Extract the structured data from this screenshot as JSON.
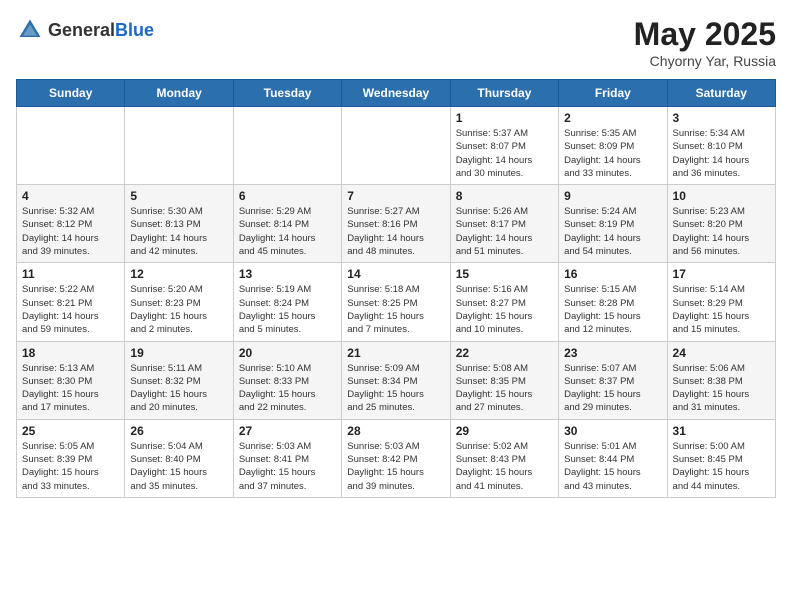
{
  "header": {
    "logo_general": "General",
    "logo_blue": "Blue",
    "month": "May 2025",
    "location": "Chyorny Yar, Russia"
  },
  "weekdays": [
    "Sunday",
    "Monday",
    "Tuesday",
    "Wednesday",
    "Thursday",
    "Friday",
    "Saturday"
  ],
  "weeks": [
    [
      {
        "day": "",
        "info": ""
      },
      {
        "day": "",
        "info": ""
      },
      {
        "day": "",
        "info": ""
      },
      {
        "day": "",
        "info": ""
      },
      {
        "day": "1",
        "info": "Sunrise: 5:37 AM\nSunset: 8:07 PM\nDaylight: 14 hours\nand 30 minutes."
      },
      {
        "day": "2",
        "info": "Sunrise: 5:35 AM\nSunset: 8:09 PM\nDaylight: 14 hours\nand 33 minutes."
      },
      {
        "day": "3",
        "info": "Sunrise: 5:34 AM\nSunset: 8:10 PM\nDaylight: 14 hours\nand 36 minutes."
      }
    ],
    [
      {
        "day": "4",
        "info": "Sunrise: 5:32 AM\nSunset: 8:12 PM\nDaylight: 14 hours\nand 39 minutes."
      },
      {
        "day": "5",
        "info": "Sunrise: 5:30 AM\nSunset: 8:13 PM\nDaylight: 14 hours\nand 42 minutes."
      },
      {
        "day": "6",
        "info": "Sunrise: 5:29 AM\nSunset: 8:14 PM\nDaylight: 14 hours\nand 45 minutes."
      },
      {
        "day": "7",
        "info": "Sunrise: 5:27 AM\nSunset: 8:16 PM\nDaylight: 14 hours\nand 48 minutes."
      },
      {
        "day": "8",
        "info": "Sunrise: 5:26 AM\nSunset: 8:17 PM\nDaylight: 14 hours\nand 51 minutes."
      },
      {
        "day": "9",
        "info": "Sunrise: 5:24 AM\nSunset: 8:19 PM\nDaylight: 14 hours\nand 54 minutes."
      },
      {
        "day": "10",
        "info": "Sunrise: 5:23 AM\nSunset: 8:20 PM\nDaylight: 14 hours\nand 56 minutes."
      }
    ],
    [
      {
        "day": "11",
        "info": "Sunrise: 5:22 AM\nSunset: 8:21 PM\nDaylight: 14 hours\nand 59 minutes."
      },
      {
        "day": "12",
        "info": "Sunrise: 5:20 AM\nSunset: 8:23 PM\nDaylight: 15 hours\nand 2 minutes."
      },
      {
        "day": "13",
        "info": "Sunrise: 5:19 AM\nSunset: 8:24 PM\nDaylight: 15 hours\nand 5 minutes."
      },
      {
        "day": "14",
        "info": "Sunrise: 5:18 AM\nSunset: 8:25 PM\nDaylight: 15 hours\nand 7 minutes."
      },
      {
        "day": "15",
        "info": "Sunrise: 5:16 AM\nSunset: 8:27 PM\nDaylight: 15 hours\nand 10 minutes."
      },
      {
        "day": "16",
        "info": "Sunrise: 5:15 AM\nSunset: 8:28 PM\nDaylight: 15 hours\nand 12 minutes."
      },
      {
        "day": "17",
        "info": "Sunrise: 5:14 AM\nSunset: 8:29 PM\nDaylight: 15 hours\nand 15 minutes."
      }
    ],
    [
      {
        "day": "18",
        "info": "Sunrise: 5:13 AM\nSunset: 8:30 PM\nDaylight: 15 hours\nand 17 minutes."
      },
      {
        "day": "19",
        "info": "Sunrise: 5:11 AM\nSunset: 8:32 PM\nDaylight: 15 hours\nand 20 minutes."
      },
      {
        "day": "20",
        "info": "Sunrise: 5:10 AM\nSunset: 8:33 PM\nDaylight: 15 hours\nand 22 minutes."
      },
      {
        "day": "21",
        "info": "Sunrise: 5:09 AM\nSunset: 8:34 PM\nDaylight: 15 hours\nand 25 minutes."
      },
      {
        "day": "22",
        "info": "Sunrise: 5:08 AM\nSunset: 8:35 PM\nDaylight: 15 hours\nand 27 minutes."
      },
      {
        "day": "23",
        "info": "Sunrise: 5:07 AM\nSunset: 8:37 PM\nDaylight: 15 hours\nand 29 minutes."
      },
      {
        "day": "24",
        "info": "Sunrise: 5:06 AM\nSunset: 8:38 PM\nDaylight: 15 hours\nand 31 minutes."
      }
    ],
    [
      {
        "day": "25",
        "info": "Sunrise: 5:05 AM\nSunset: 8:39 PM\nDaylight: 15 hours\nand 33 minutes."
      },
      {
        "day": "26",
        "info": "Sunrise: 5:04 AM\nSunset: 8:40 PM\nDaylight: 15 hours\nand 35 minutes."
      },
      {
        "day": "27",
        "info": "Sunrise: 5:03 AM\nSunset: 8:41 PM\nDaylight: 15 hours\nand 37 minutes."
      },
      {
        "day": "28",
        "info": "Sunrise: 5:03 AM\nSunset: 8:42 PM\nDaylight: 15 hours\nand 39 minutes."
      },
      {
        "day": "29",
        "info": "Sunrise: 5:02 AM\nSunset: 8:43 PM\nDaylight: 15 hours\nand 41 minutes."
      },
      {
        "day": "30",
        "info": "Sunrise: 5:01 AM\nSunset: 8:44 PM\nDaylight: 15 hours\nand 43 minutes."
      },
      {
        "day": "31",
        "info": "Sunrise: 5:00 AM\nSunset: 8:45 PM\nDaylight: 15 hours\nand 44 minutes."
      }
    ]
  ]
}
